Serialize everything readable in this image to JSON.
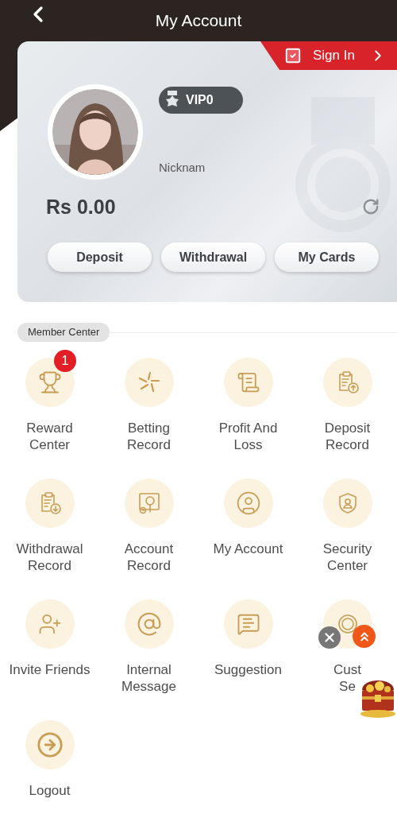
{
  "header": {
    "title": "My Account"
  },
  "account": {
    "sign_in": "Sign In",
    "vip": "VIP0",
    "nickname": "Nicknam",
    "balance": "Rs 0.00",
    "actions": [
      "Deposit",
      "Withdrawal",
      "My Cards"
    ]
  },
  "section": {
    "title": "Member Center"
  },
  "menu": [
    {
      "lines": [
        "Reward",
        "Center"
      ],
      "badge": "1"
    },
    {
      "lines": [
        "Betting",
        "Record"
      ]
    },
    {
      "lines": [
        "Profit And",
        "Loss"
      ]
    },
    {
      "lines": [
        "Deposit",
        "Record"
      ]
    },
    {
      "lines": [
        "Withdrawal",
        "Record"
      ]
    },
    {
      "lines": [
        "Account",
        "Record"
      ]
    },
    {
      "lines": [
        "My Account"
      ]
    },
    {
      "lines": [
        "Security",
        "Center"
      ]
    },
    {
      "lines": [
        "Invite Friends"
      ]
    },
    {
      "lines": [
        "Internal",
        "Message"
      ]
    },
    {
      "lines": [
        "Suggestion"
      ]
    },
    {
      "lines": [
        "Cust",
        "Se"
      ]
    },
    {
      "lines": [
        "Logout"
      ]
    }
  ]
}
